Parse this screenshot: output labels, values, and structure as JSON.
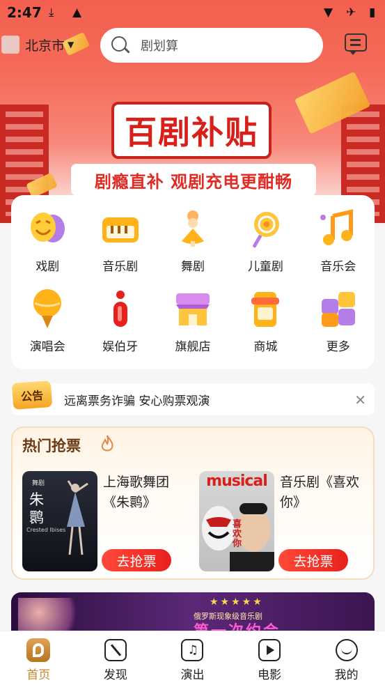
{
  "status_bar": {
    "time": "2:47"
  },
  "header": {
    "city": "北京市",
    "search_placeholder": "剧划算"
  },
  "banner": {
    "title": "百剧补贴",
    "subtitle": "剧瘾直补 观剧充电更酣畅"
  },
  "categories": [
    {
      "label": "戏剧",
      "icon": "drama-mask-icon"
    },
    {
      "label": "音乐剧",
      "icon": "piano-icon"
    },
    {
      "label": "舞剧",
      "icon": "dancer-icon"
    },
    {
      "label": "儿童剧",
      "icon": "lollipop-icon"
    },
    {
      "label": "音乐会",
      "icon": "music-note-icon"
    },
    {
      "label": "演唱会",
      "icon": "microphone-icon"
    },
    {
      "label": "娱伯牙",
      "icon": "yuboya-logo-icon"
    },
    {
      "label": "旗舰店",
      "icon": "storefront-icon"
    },
    {
      "label": "商城",
      "icon": "phone-shop-icon"
    },
    {
      "label": "更多",
      "icon": "puzzle-icon"
    }
  ],
  "notice": {
    "tag": "公告",
    "text": "远离票务诈骗  安心购票观演"
  },
  "hot": {
    "title": "热门抢票",
    "shows": [
      {
        "name": "上海歌舞团《朱鹮》",
        "button": "去抢票",
        "poster_big": "朱鹮",
        "poster_top": "舞剧",
        "poster_en": "Crested Ibises"
      },
      {
        "name": "音乐剧《喜欢你》",
        "button": "去抢票",
        "poster_top": "musical",
        "poster_big": "喜欢你"
      }
    ]
  },
  "promo": {
    "stars": "★★★★★",
    "sub": "俄罗斯现象级音乐剧",
    "big": "第一次约会"
  },
  "tabs": [
    {
      "label": "首页",
      "icon": "home-logo-icon",
      "active": true
    },
    {
      "label": "发现",
      "icon": "compass-icon",
      "active": false
    },
    {
      "label": "演出",
      "icon": "music-note-icon",
      "active": false
    },
    {
      "label": "电影",
      "icon": "film-icon",
      "active": false
    },
    {
      "label": "我的",
      "icon": "profile-smile-icon",
      "active": false
    }
  ],
  "colors": {
    "accent": "#e8201c",
    "gold": "#c9862c",
    "header_top": "#f4604f"
  }
}
